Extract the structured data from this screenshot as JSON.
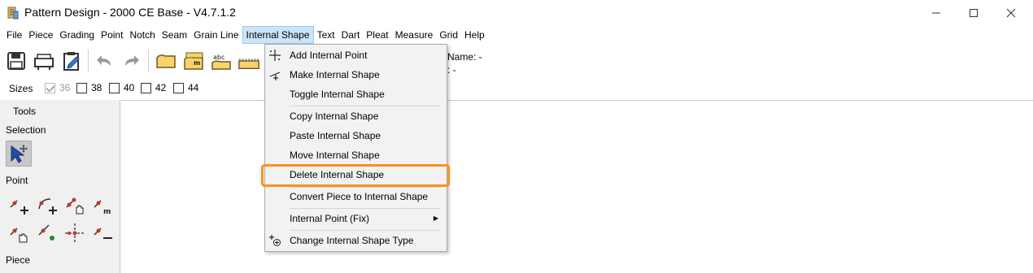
{
  "window": {
    "title": "Pattern Design - 2000 CE Base - V4.7.1.2",
    "minimize": "minimize",
    "maximize": "maximize",
    "close": "close"
  },
  "menubar": {
    "items": [
      "File",
      "Piece",
      "Grading",
      "Point",
      "Notch",
      "Seam",
      "Grain Line",
      "Internal Shape",
      "Text",
      "Dart",
      "Pleat",
      "Measure",
      "Grid",
      "Help"
    ],
    "active": "Internal Shape"
  },
  "toolbar": {
    "info_name": "Name: -",
    "info_second": ": -"
  },
  "sizes": {
    "label": "Sizes",
    "items": [
      {
        "label": "36",
        "checked": true,
        "disabled": true
      },
      {
        "label": "38",
        "checked": false,
        "disabled": false
      },
      {
        "label": "40",
        "checked": false,
        "disabled": false
      },
      {
        "label": "42",
        "checked": false,
        "disabled": false
      },
      {
        "label": "44",
        "checked": false,
        "disabled": false
      }
    ]
  },
  "tools": {
    "title": "Tools",
    "sections": {
      "selection": "Selection",
      "point": "Point",
      "piece": "Piece"
    }
  },
  "dropdown": {
    "items": [
      {
        "label": "Add Internal Point",
        "icon": "add-point-icon"
      },
      {
        "label": "Make Internal Shape",
        "icon": "make-shape-icon"
      },
      {
        "label": "Toggle Internal Shape",
        "icon": ""
      },
      {
        "label": "Copy Internal Shape",
        "icon": ""
      },
      {
        "label": "Paste Internal Shape",
        "icon": ""
      },
      {
        "label": "Move Internal Shape",
        "icon": ""
      },
      {
        "label": "Delete Internal Shape",
        "icon": "",
        "highlighted": true
      },
      {
        "label": "Convert Piece to Internal Shape",
        "icon": ""
      },
      {
        "label": "Internal Point (Fix)",
        "icon": "",
        "submenu": true
      },
      {
        "label": "Change Internal Shape Type",
        "icon": "change-type-icon"
      }
    ]
  },
  "colors": {
    "highlight_border": "#f7941d",
    "menu_active_bg": "#cce4f7",
    "point_red": "#c0392b",
    "point_green": "#1e8a3a",
    "tool_icon_yellow": "#f6d36b"
  }
}
